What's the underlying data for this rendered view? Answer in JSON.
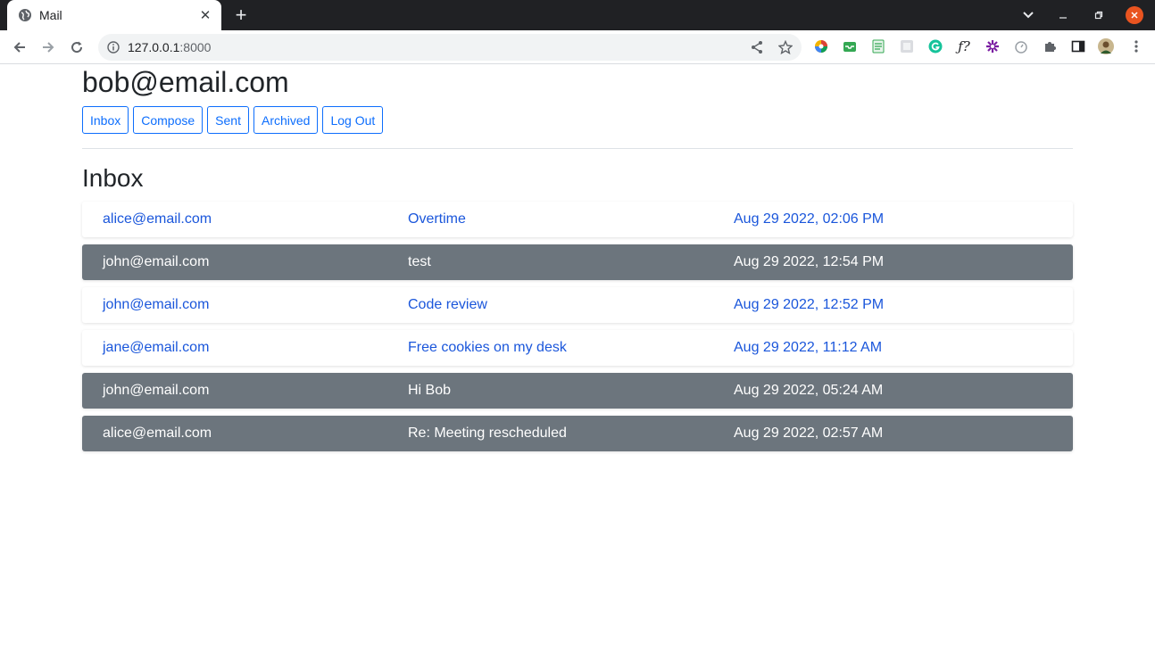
{
  "browser": {
    "tab_title": "Mail",
    "url_host": "127.0.0.1",
    "url_port": ":8000"
  },
  "page": {
    "user_email": "bob@email.com",
    "nav": {
      "inbox": "Inbox",
      "compose": "Compose",
      "sent": "Sent",
      "archived": "Archived",
      "logout": "Log Out"
    },
    "section_title": "Inbox",
    "emails": [
      {
        "sender": "alice@email.com",
        "subject": "Overtime",
        "timestamp": "Aug 29 2022, 02:06 PM",
        "read": false
      },
      {
        "sender": "john@email.com",
        "subject": "test",
        "timestamp": "Aug 29 2022, 12:54 PM",
        "read": true
      },
      {
        "sender": "john@email.com",
        "subject": "Code review",
        "timestamp": "Aug 29 2022, 12:52 PM",
        "read": false
      },
      {
        "sender": "jane@email.com",
        "subject": "Free cookies on my desk",
        "timestamp": "Aug 29 2022, 11:12 AM",
        "read": false
      },
      {
        "sender": "john@email.com",
        "subject": "Hi Bob",
        "timestamp": "Aug 29 2022, 05:24 AM",
        "read": true
      },
      {
        "sender": "alice@email.com",
        "subject": "Re: Meeting rescheduled",
        "timestamp": "Aug 29 2022, 02:57 AM",
        "read": true
      }
    ]
  },
  "colors": {
    "accent": "#0d6efd",
    "unread_text": "#1a56db",
    "read_bg": "#6c757d",
    "chrome_dark": "#202124"
  }
}
